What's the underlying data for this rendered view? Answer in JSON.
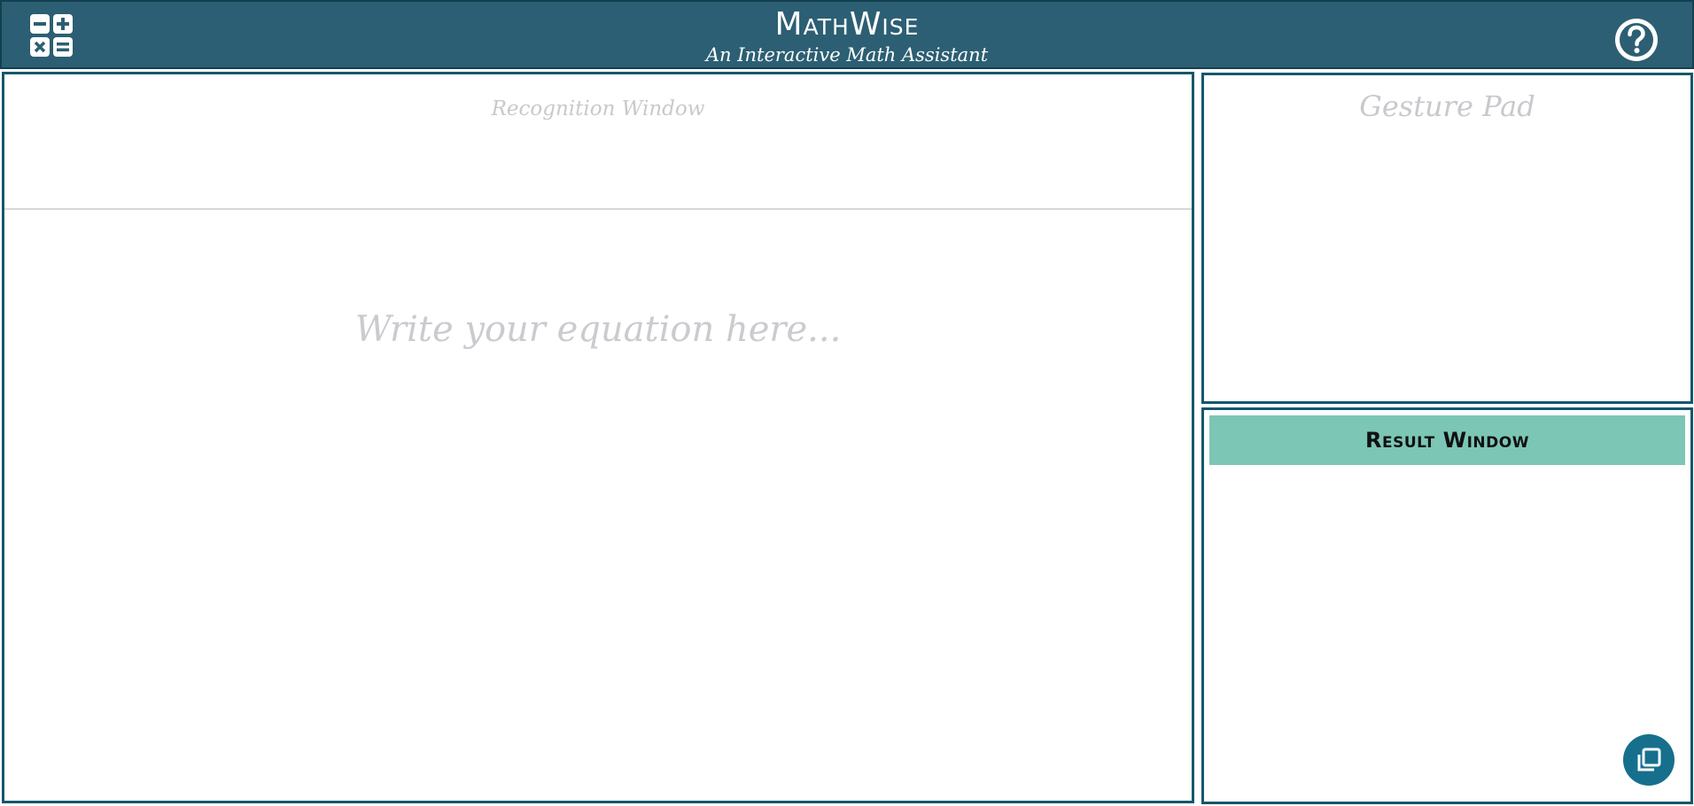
{
  "header": {
    "title": "MathWise",
    "subtitle": "An Interactive Math Assistant",
    "logo_icon": "calculator-icon",
    "help_icon": "help-circle-icon"
  },
  "recognition": {
    "label": "Recognition Window",
    "placeholder": "Write your equation here..."
  },
  "gesture_pad": {
    "label": "Gesture Pad"
  },
  "result": {
    "title": "Result Window",
    "copy_icon": "copy-icon"
  },
  "colors": {
    "header_bg": "#2c5f73",
    "panel_border": "#14576b",
    "result_banner": "#7cc6b6",
    "placeholder_text": "#c9cbcf",
    "copy_button": "#166f8d"
  }
}
